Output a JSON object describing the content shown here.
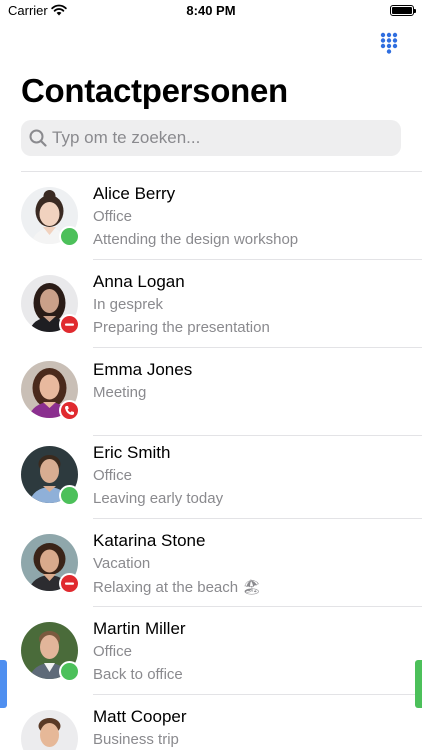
{
  "status_bar": {
    "carrier": "Carrier",
    "time": "8:40 PM",
    "battery_level": 1.0
  },
  "header": {
    "title": "Contactpersonen",
    "dialpad_icon": "dialpad-icon"
  },
  "search": {
    "placeholder": "Typ om te zoeken...",
    "value": ""
  },
  "colors": {
    "accent": "#2f6ee0",
    "available": "#4cc05a",
    "busy": "#e02a2f",
    "secondary_text": "#8a8a8e"
  },
  "contacts": [
    {
      "name": "Alice Berry",
      "status": "Office",
      "note": "Attending the design workshop",
      "presence": "available",
      "presence_icon": "available-dot-icon"
    },
    {
      "name": "Anna Logan",
      "status": "In gesprek",
      "note": "Preparing the presentation",
      "presence": "busy",
      "presence_icon": "do-not-disturb-icon"
    },
    {
      "name": "Emma Jones",
      "status": "Meeting",
      "note": "",
      "presence": "on-call",
      "presence_icon": "phone-icon"
    },
    {
      "name": "Eric Smith",
      "status": "Office",
      "note": "Leaving early today",
      "presence": "available",
      "presence_icon": "available-dot-icon"
    },
    {
      "name": "Katarina Stone",
      "status": "Vacation",
      "note": "Relaxing at the beach 🏖",
      "presence": "busy",
      "presence_icon": "do-not-disturb-icon"
    },
    {
      "name": "Martin Miller",
      "status": "Office",
      "note": "Back to office",
      "presence": "available",
      "presence_icon": "available-dot-icon"
    },
    {
      "name": "Matt Cooper",
      "status": "Business trip",
      "note": "",
      "presence": "",
      "presence_icon": ""
    }
  ]
}
